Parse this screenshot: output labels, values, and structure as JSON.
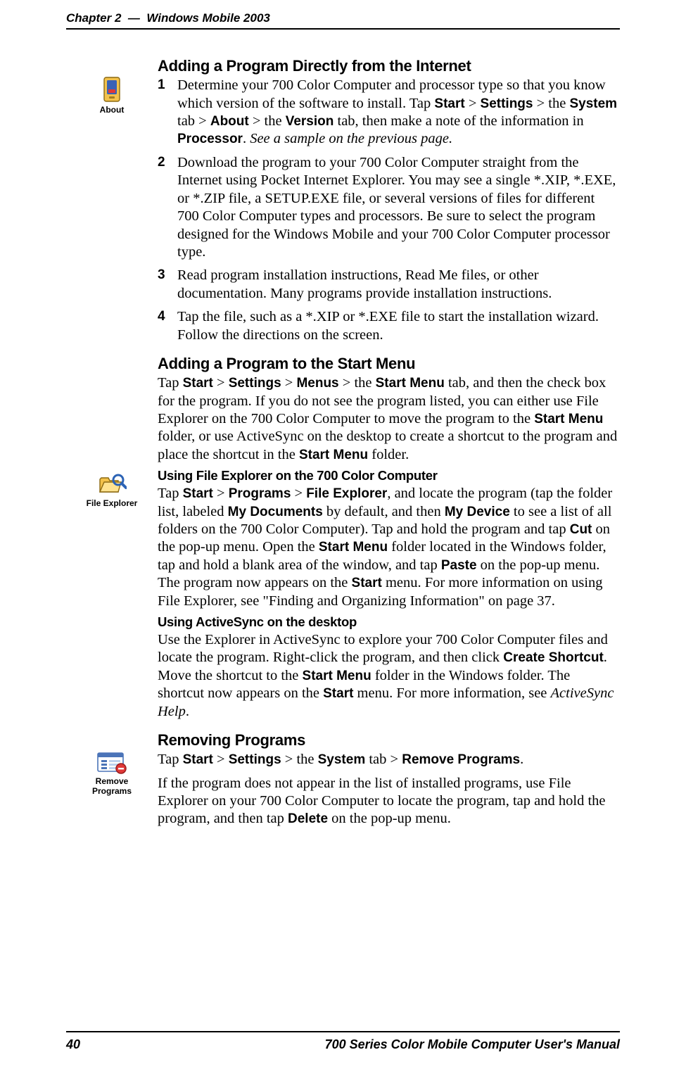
{
  "header": {
    "chapter": "Chapter 2",
    "sep": "—",
    "title": "Windows Mobile 2003"
  },
  "footer": {
    "page": "40",
    "manual": "700 Series Color Mobile Computer User's Manual"
  },
  "icons": {
    "about": "About",
    "fileExplorer": "File Explorer",
    "removePrograms": "Remove Programs"
  },
  "sections": {
    "addInternet": {
      "title": "Adding a Program Directly from the Internet",
      "steps": {
        "n1": "1",
        "s1a": "Determine your 700 Color Computer and processor type so that you know which version of the software to install. Tap ",
        "s1b": " > ",
        "s1c": " > the ",
        "s1d": " tab > ",
        "s1e": " > the ",
        "s1f": " tab, then make a note of the information in ",
        "s1g": ". ",
        "s1h": "See a sample on the previous page.",
        "w_start": "Start",
        "w_settings": "Settings",
        "w_system": "System",
        "w_about": "About",
        "w_version": "Version",
        "w_processor": "Processor",
        "n2": "2",
        "s2": "Download the program to your 700 Color Computer straight from the Internet using Pocket Internet Explorer. You may see a single *.XIP, *.EXE, or *.ZIP file, a SETUP.EXE file, or several versions of files for different 700 Color Computer types and processors. Be sure to select the program designed for the Windows Mobile and your 700 Color Computer processor type.",
        "n3": "3",
        "s3": "Read program installation instructions, Read Me files, or other documentation. Many programs provide installation instructions.",
        "n4": "4",
        "s4": "Tap the file, such as a *.XIP or *.EXE file to start the installation wizard. Follow the directions on the screen."
      }
    },
    "addStart": {
      "title": "Adding a Program to the Start Menu",
      "p1a": "Tap ",
      "w_start": "Start",
      "p1b": " > ",
      "w_settings": "Settings",
      "p1c": " > ",
      "w_menus": "Menus",
      "p1d": " > the ",
      "w_startmenu": "Start Menu",
      "p1e": " tab, and then the check box for the program. If you do not see the program listed, you can either use File Explorer on the 700 Color Computer to move the program to the ",
      "p1f": " folder, or use ActiveSync on the desktop to create a shortcut to the program and place the shortcut in the ",
      "p1g": " folder."
    },
    "fileExplorer": {
      "title": "Using File Explorer on the 700 Color Computer",
      "p_a": "Tap ",
      "w_start": "Start",
      "p_b": " > ",
      "w_programs": "Programs",
      "p_c": " > ",
      "w_fex": "File Explorer",
      "p_d": ", and locate the program (tap the folder list, labeled ",
      "w_mydocs": "My Documents",
      "p_e": " by default, and then ",
      "w_mydev": "My Device",
      "p_f": " to see a list of all folders on the 700 Color Computer). Tap and hold the program and tap ",
      "w_cut": "Cut",
      "p_g": " on the pop-up menu. Open the ",
      "w_startmenu": "Start Menu",
      "p_h": " folder located in the Windows folder, tap and hold a blank area of the window, and tap ",
      "w_paste": "Paste",
      "p_i": " on the pop-up menu. The program now appears on the ",
      "w_start2": "Start",
      "p_j": " menu. For more information on using File Explorer, see \"Finding and Organizing Information\" on page 37."
    },
    "activesync": {
      "title": "Using ActiveSync on the desktop",
      "p_a": "Use the Explorer in ActiveSync to explore your 700 Color Computer files and locate the program. Right-click the program, and then click ",
      "w_cs": "Create Shortcut",
      "p_b": ". Move the shortcut to the ",
      "w_startmenu": "Start Menu",
      "p_c": " folder in the Windows folder. The shortcut now appears on the ",
      "w_start": "Start",
      "p_d": " menu. For more information, see ",
      "w_help": "ActiveSync Help",
      "p_e": "."
    },
    "remove": {
      "title": "Removing Programs",
      "p1a": "Tap ",
      "w_start": "Start",
      "p1b": " > ",
      "w_settings": "Settings",
      "p1c": " > the ",
      "w_system": "System",
      "p1d": " tab > ",
      "w_rp": "Remove Programs",
      "p1e": ".",
      "p2a": "If the program does not appear in the list of installed programs, use File Explorer on your 700 Color Computer to locate the program, tap and hold the program, and then tap ",
      "w_delete": "Delete",
      "p2b": " on the pop-up menu."
    }
  }
}
